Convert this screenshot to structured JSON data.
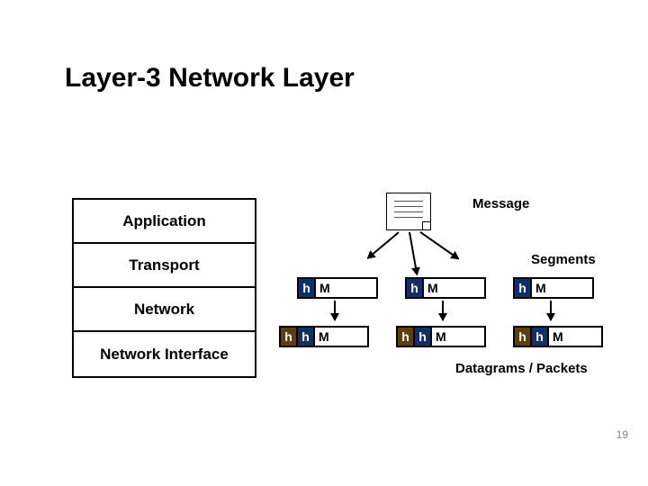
{
  "title": "Layer-3 Network Layer",
  "layers": {
    "application": "Application",
    "transport": "Transport",
    "network": "Network",
    "interface": "Network Interface"
  },
  "labels": {
    "message": "Message",
    "segments": "Segments",
    "datagrams": "Datagrams / Packets"
  },
  "pdu": {
    "transport_header": "h",
    "network_header": "h",
    "body": "M"
  },
  "slide_number": "19",
  "chart_data": {
    "type": "diagram",
    "description": "Encapsulation of a Message at the Application layer into three Transport-layer Segments (h|M), each further wrapped into Network-layer Datagrams/Packets (h|h|M). Four-layer stack shown: Application, Transport, Network, Network Interface.",
    "layers": [
      "Application",
      "Transport",
      "Network",
      "Network Interface"
    ],
    "encapsulation": [
      {
        "layer": "Application",
        "unit": "Message",
        "structure": [
          "M"
        ]
      },
      {
        "layer": "Transport",
        "unit": "Segment",
        "count": 3,
        "structure": [
          "h",
          "M"
        ]
      },
      {
        "layer": "Network",
        "unit": "Datagram/Packet",
        "count": 3,
        "structure": [
          "h",
          "h",
          "M"
        ]
      }
    ]
  }
}
